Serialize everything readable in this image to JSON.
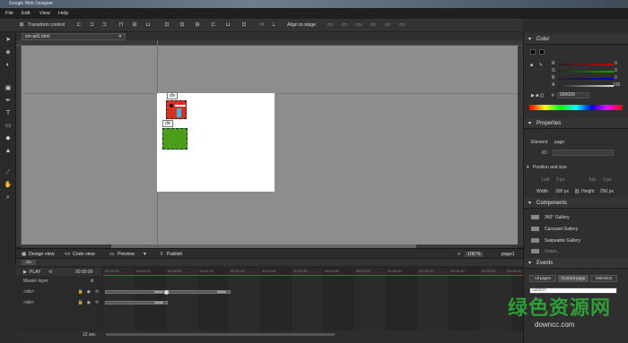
{
  "window": {
    "title": "Google Web Designer"
  },
  "menu": [
    "File",
    "Edit",
    "View",
    "Help"
  ],
  "toolbar": {
    "transform_label": "Transform control",
    "align_label": "Align to stage"
  },
  "document": {
    "tab_label": "sm-ad1.html",
    "close": "✕"
  },
  "stage": {
    "labels": [
      "div",
      "div"
    ]
  },
  "bottombar": {
    "design_view": "Design view",
    "code_view": "Code view",
    "preview": "Preview",
    "publish": "Publish",
    "zoom": "100 %",
    "page": "page1"
  },
  "timeline": {
    "tab": "div",
    "play_label": "PLAY",
    "time": "00:00:00",
    "ticks": [
      "00:00:00",
      "00:00:25",
      "00:00:50",
      "00:01:15",
      "00:01:40",
      "00:02:05",
      "00:02:30",
      "00:02:55",
      "00:03:20",
      "00:03:45",
      "00:04:10",
      "00:04:35",
      "00:05:00",
      "00:05:25",
      "00:05:50"
    ],
    "rows": [
      "Master layer",
      "<div>",
      "<div>"
    ],
    "bar_labels": [
      "linear",
      "linear",
      "linear"
    ],
    "duration": "12 sec"
  },
  "color": {
    "title": "Color",
    "channels": [
      "R",
      "G",
      "B",
      "A"
    ],
    "values": [
      "0",
      "0",
      "0",
      "100"
    ],
    "hex": "000000"
  },
  "properties": {
    "title": "Properties",
    "element_label": "Element",
    "element_value": "page",
    "id_label": "ID",
    "pos_title": "Position and size",
    "left_label": "Left",
    "left_value": "0 px",
    "top_label": "Top",
    "top_value": "0 px",
    "width_label": "Width",
    "width_value": "300 px",
    "height_label": "Height",
    "height_value": "250 px"
  },
  "components": {
    "title": "Components",
    "items": [
      "360° Gallery",
      "Carousel Gallery",
      "Swipeable Gallery",
      "Swipe..."
    ]
  },
  "events": {
    "title": "Events",
    "tabs": [
      "All pages",
      "Current page",
      "Selection"
    ],
    "search_placeholder": "Search"
  },
  "watermark": {
    "text": "绿色资源网",
    "url": "downcc.com"
  }
}
